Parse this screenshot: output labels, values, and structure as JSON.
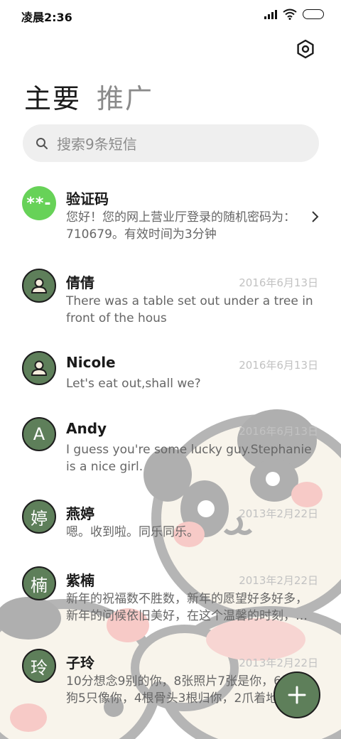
{
  "status_bar": {
    "time": "凌晨2:36"
  },
  "tabs": {
    "main": "主要",
    "promotions": "推广"
  },
  "search": {
    "placeholder": "搜索9条短信"
  },
  "colors": {
    "avatar_green": "#5e7f5a",
    "code_avatar": "#67d258",
    "search_bg": "#efefef"
  },
  "messages": [
    {
      "avatar_type": "code",
      "avatar_text": "**-",
      "name": "验证码",
      "date": "",
      "preview": "您好！您的网上营业厅登录的随机密码为：710679。有效时间为3分钟"
    },
    {
      "avatar_type": "person-icon",
      "avatar_text": "",
      "name": "倩倩",
      "date": "2016年6月13日",
      "preview": "There was a table set out under a tree in front of the hous"
    },
    {
      "avatar_type": "person-icon",
      "avatar_text": "",
      "name": "Nicole",
      "date": "2016年6月13日",
      "preview": "Let's eat out,shall we?"
    },
    {
      "avatar_type": "letter",
      "avatar_text": "A",
      "name": "Andy",
      "date": "2016年6月13日",
      "preview": "I guess you're some lucky guy.Stephanie is a nice girl."
    },
    {
      "avatar_type": "letter",
      "avatar_text": "婷",
      "name": "燕婷",
      "date": "2013年2月22日",
      "preview": "嗯。收到啦。同乐同乐。"
    },
    {
      "avatar_type": "letter",
      "avatar_text": "楠",
      "name": "紫楠",
      "date": "2013年2月22日",
      "preview": "新年的祝福数不胜数，新年的愿望好多好多，新年的问候依旧美好，在这个温馨的时刻，…"
    },
    {
      "avatar_type": "letter",
      "avatar_text": "玲",
      "name": "子玲",
      "date": "2013年2月22日",
      "preview": "10分想念9别的你，8张照片7张是你，6只小狗5只像你，4根骨头3根归你，2爪着地"
    }
  ],
  "icons": {
    "settings": "hexagon-settings-icon",
    "search": "search-icon",
    "fab": "plus-icon"
  }
}
